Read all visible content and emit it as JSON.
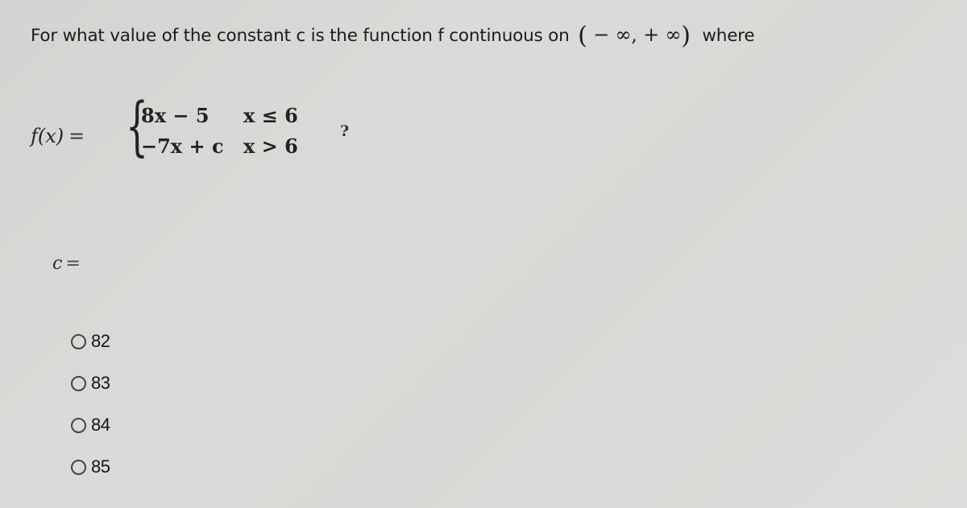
{
  "question": {
    "prefix": "For what value of the constant c is the function f continuous on",
    "open_paren": "(",
    "interval_left": "− ∞,",
    "interval_right": "+ ∞",
    "close_paren": ")",
    "suffix": "where"
  },
  "formula": {
    "lhs": "f(x)",
    "equals": "=",
    "brace": "{",
    "cases": [
      {
        "expression": "8x − 5",
        "condition": "x ≤ 6"
      },
      {
        "expression": "−7x + c",
        "condition": "x > 6"
      }
    ],
    "trailing": "?"
  },
  "answer_prompt": {
    "variable": "c",
    "equals": "="
  },
  "options": [
    {
      "label": "82",
      "selected": false
    },
    {
      "label": "83",
      "selected": false
    },
    {
      "label": "84",
      "selected": false
    },
    {
      "label": "85",
      "selected": false
    }
  ]
}
